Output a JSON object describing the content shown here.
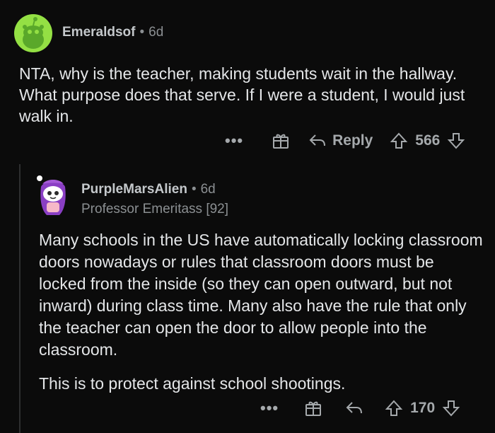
{
  "comment": {
    "author": "Emeraldsof",
    "separator": "•",
    "time": "6d",
    "body": "NTA, why is the teacher, making students wait in the hallway. What purpose does that serve. If I were a student, I would just walk in.",
    "actions": {
      "more": "•••",
      "reply_label": "Reply",
      "score": "566"
    }
  },
  "reply": {
    "author": "PurpleMarsAlien",
    "separator": "•",
    "time": "6d",
    "flair": "Professor Emeritass [92]",
    "paragraphs": [
      "Many schools in the US have automatically locking classroom doors nowadays or rules that classroom doors must be locked from the inside (so they can open outward, but not inward) during class time. Many also have the rule that only the teacher can open the door to allow people into the classroom.",
      "This is to protect against school shootings."
    ],
    "actions": {
      "more": "•••",
      "score": "170"
    }
  },
  "colors": {
    "background": "#0b0b0b",
    "avatar1": "#94e044",
    "avatar2_hair": "#8a3fc4",
    "text": "#e4e6e8",
    "meta": "#8b8f92"
  },
  "icons": [
    "snoo-avatar-icon",
    "award-gift-icon",
    "reply-arrow-icon",
    "upvote-icon",
    "downvote-icon",
    "more-dots-icon"
  ]
}
